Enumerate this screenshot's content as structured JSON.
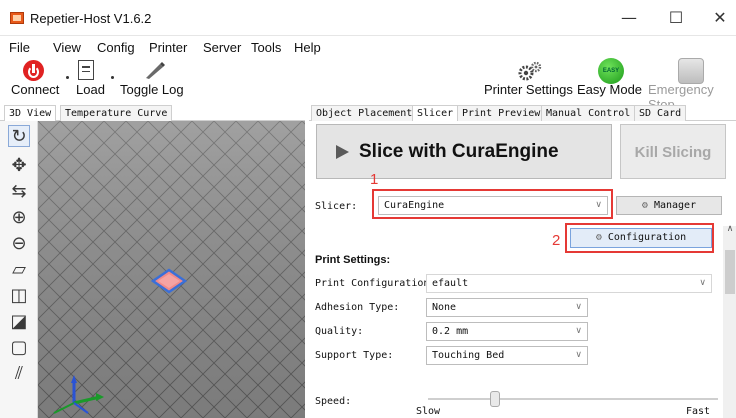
{
  "window": {
    "title": "Repetier-Host V1.6.2",
    "controls": {
      "minimize": "—",
      "maximize": "☐",
      "close": "✕"
    }
  },
  "menu": [
    "File",
    "View",
    "Config",
    "Printer",
    "Server",
    "Tools",
    "Help"
  ],
  "toolbar": {
    "connect": "Connect",
    "load": "Load",
    "toggle_log": "Toggle Log",
    "printer_settings": "Printer Settings",
    "easy_mode": "Easy Mode",
    "easy_badge": "EASY",
    "emergency_stop": "Emergency Stop"
  },
  "left_tabs": [
    "3D View",
    "Temperature Curve"
  ],
  "right_tabs": [
    "Object Placement",
    "Slicer",
    "Print Preview",
    "Manual Control",
    "SD Card"
  ],
  "slicer": {
    "slice_button": "Slice with CuraEngine",
    "kill_button": "Kill Slicing",
    "slicer_label": "Slicer:",
    "slicer_value": "CuraEngine",
    "manager_button": "Manager",
    "configuration_button": "Configuration",
    "print_settings_heading": "Print Settings:",
    "print_config_label": "Print Configuration:",
    "print_config_value": "efault",
    "adhesion_label": "Adhesion Type:",
    "adhesion_value": "None",
    "quality_label": "Quality:",
    "quality_value": "0.2 mm",
    "support_label": "Support Type:",
    "support_value": "Touching Bed",
    "speed_label": "Speed:",
    "speed_slow": "Slow",
    "speed_fast": "Fast"
  },
  "annotations": {
    "one": "1",
    "two": "2"
  },
  "colors": {
    "annotation_red": "#e53935",
    "grid_background": "#8a8a8a",
    "object_fill": "#f08a8a",
    "object_outline": "#3a6fd8"
  },
  "icons": [
    "connect-icon",
    "load-icon",
    "toggle-log-icon",
    "printer-settings-icon",
    "easy-mode-icon",
    "emergency-stop-icon"
  ]
}
